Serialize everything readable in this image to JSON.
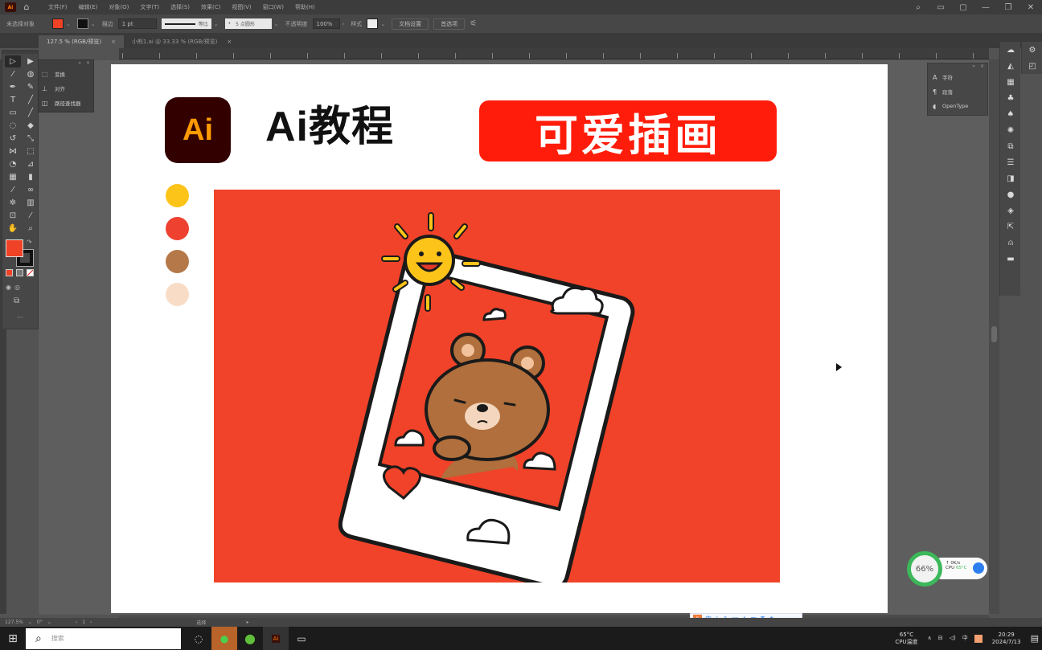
{
  "app": {
    "name": "Adobe Illustrator",
    "logo_text": "Ai",
    "menu": [
      "文件(F)",
      "编辑(E)",
      "对象(O)",
      "文字(T)",
      "选择(S)",
      "效果(C)",
      "视图(V)",
      "窗口(W)",
      "帮助(H)"
    ],
    "window_controls": [
      "search-icon",
      "workspace-icon",
      "arrange-icon",
      "minimize",
      "restore",
      "close"
    ]
  },
  "control_bar": {
    "selection_label": "未选择对象",
    "fill_color": "#f04226",
    "stroke_label": "描边",
    "stroke_weight": "1 pt",
    "stroke_profile": "等比",
    "brush": "5 点圆形",
    "opacity_label": "不透明度",
    "opacity_value": "100%",
    "style_label": "样式",
    "doc_setup_button": "文档设置",
    "prefs_button": "首选项"
  },
  "tabs": [
    {
      "label": "127.5 % (RGB/预览)",
      "active": true
    },
    {
      "label": "小熊1.ai @ 33.33 % (RGB/预览)",
      "active": false
    }
  ],
  "tool_flyout": {
    "items": [
      {
        "icon": "align-icon",
        "label": "变换"
      },
      {
        "icon": "align-center-icon",
        "label": "对齐"
      },
      {
        "icon": "pathfinder-icon",
        "label": "路径查找器"
      }
    ]
  },
  "char_panel": {
    "items": [
      {
        "icon": "character-icon",
        "label": "字符"
      },
      {
        "icon": "paragraph-icon",
        "label": "段落"
      },
      {
        "icon": "opentype-icon",
        "label": "OpenType"
      }
    ]
  },
  "artboard": {
    "logo_text": "Ai",
    "title": "Ai教程",
    "banner": "可爱插画",
    "palette": [
      "#fcc419",
      "#ef4130",
      "#b57949",
      "#f8dcc6"
    ],
    "illustration": {
      "background": "#f04329",
      "subject": "bear in polaroid frame with sun, clouds and heart"
    }
  },
  "status_bar": {
    "zoom": "127.5%",
    "angle": "0°",
    "artboard_nav": "1",
    "tool": "选择"
  },
  "ime_toolbar": {
    "logo": "S",
    "mode": "中"
  },
  "perf_widget": {
    "usage": "66%",
    "speed": "0K/s",
    "cpu_label": "CPU",
    "cpu_temp": "65°C"
  },
  "taskbar": {
    "search_placeholder": "搜索",
    "apps": [
      "task-view",
      "wechat",
      "browser",
      "illustrator",
      "video"
    ],
    "temp": "65°C",
    "temp_label": "CPU温度",
    "time": "20:29",
    "date": "2024/7/13",
    "ime": "中"
  }
}
